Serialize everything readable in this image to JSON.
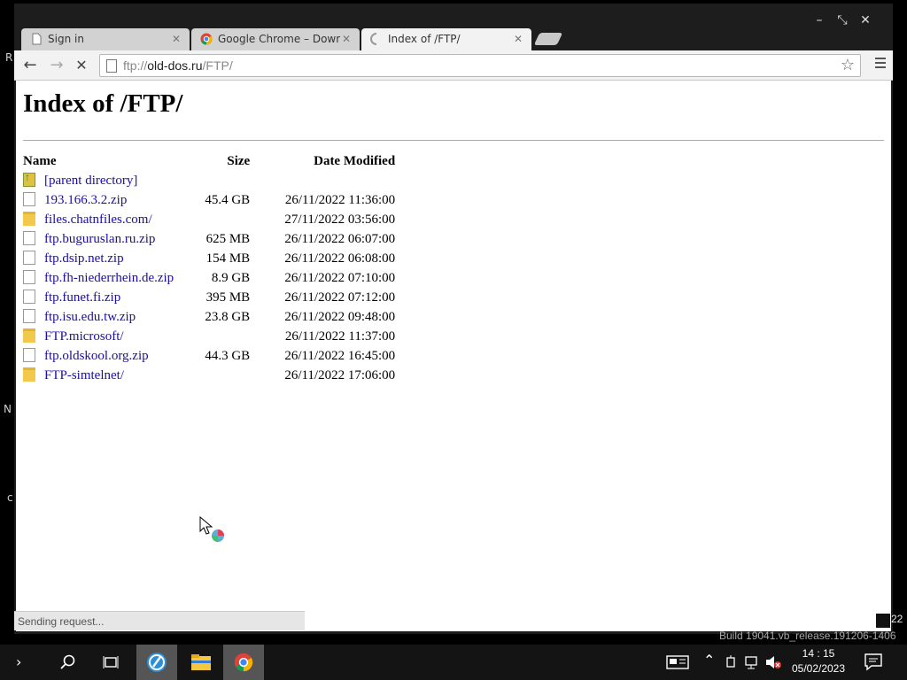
{
  "desktop": {
    "left_glyphs": [
      "R",
      "N",
      "c"
    ]
  },
  "window": {
    "controls": {
      "minimize": "–",
      "maximize": "⤡",
      "close": "✕"
    }
  },
  "tabs": [
    {
      "label": "Sign in",
      "icon": "page-icon"
    },
    {
      "label": "Google Chrome – Downl",
      "icon": "chrome-icon"
    },
    {
      "label": "Index of /FTP/",
      "icon": "loading-icon"
    }
  ],
  "toolbar": {
    "back": "←",
    "forward": "→",
    "stop": "✕",
    "url_scheme": "ftp://",
    "url_host": "old-dos.ru",
    "url_path": "/FTP/"
  },
  "page": {
    "title": "Index of /FTP/",
    "headers": {
      "name": "Name",
      "size": "Size",
      "date": "Date Modified"
    },
    "rows": [
      {
        "type": "up",
        "name": "[parent directory]",
        "size": "",
        "date": ""
      },
      {
        "type": "file",
        "name": "193.166.3.2.zip",
        "size": "45.4 GB",
        "date": "26/11/2022 11:36:00"
      },
      {
        "type": "folder",
        "name": "files.chatnfiles.com/",
        "size": "",
        "date": "27/11/2022 03:56:00"
      },
      {
        "type": "file",
        "name": "ftp.buguruslan.ru.zip",
        "size": "625 MB",
        "date": "26/11/2022 06:07:00"
      },
      {
        "type": "file",
        "name": "ftp.dsip.net.zip",
        "size": "154 MB",
        "date": "26/11/2022 06:08:00"
      },
      {
        "type": "file",
        "name": "ftp.fh-niederrhein.de.zip",
        "size": "8.9 GB",
        "date": "26/11/2022 07:10:00"
      },
      {
        "type": "file",
        "name": "ftp.funet.fi.zip",
        "size": "395 MB",
        "date": "26/11/2022 07:12:00"
      },
      {
        "type": "file",
        "name": "ftp.isu.edu.tw.zip",
        "size": "23.8 GB",
        "date": "26/11/2022 09:48:00"
      },
      {
        "type": "folder",
        "name": "FTP.microsoft/",
        "size": "",
        "date": "26/11/2022 11:37:00"
      },
      {
        "type": "file",
        "name": "ftp.oldskool.org.zip",
        "size": "44.3 GB",
        "date": "26/11/2022 16:45:00"
      },
      {
        "type": "folder",
        "name": "FTP-simtelnet/",
        "size": "",
        "date": "26/11/2022 17:06:00"
      }
    ]
  },
  "status_text": "Sending request...",
  "desktop_corner": {
    "number": "22",
    "build": "Build 19041.vb_release.191206-1406"
  },
  "taskbar": {
    "time": "14 : 15",
    "date": "05/02/2023"
  }
}
